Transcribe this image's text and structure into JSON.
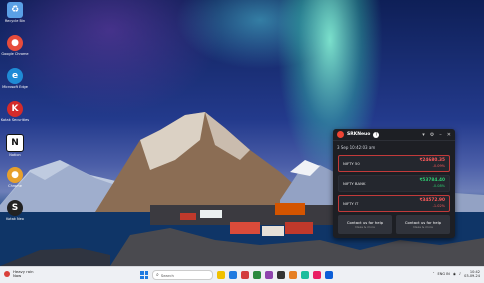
{
  "desktop": {
    "icons": [
      {
        "name": "Recycle Bin",
        "glyph": "♻",
        "color": "#5aa0e6"
      },
      {
        "name": "Google Chrome",
        "glyph": "●",
        "color": "#e74c3c"
      },
      {
        "name": "Microsoft Edge",
        "glyph": "e",
        "color": "#1f8bd6"
      },
      {
        "name": "Kotak Securities",
        "glyph": "K",
        "color": "#d42b2b"
      },
      {
        "name": "Notion",
        "glyph": "N",
        "color": "#111111"
      },
      {
        "name": "Chrome",
        "glyph": "●",
        "color": "#e7a02b"
      },
      {
        "name": "Kotak Neo",
        "glyph": "S",
        "color": "#222222"
      }
    ]
  },
  "widget": {
    "title": "SRKNeuo",
    "help": "?",
    "date_time": "3 Sep 10:42:03 am",
    "rows": [
      {
        "name": "NIFTY 50",
        "price": "₹24680.35",
        "change": "-0.09%",
        "dir": "down"
      },
      {
        "name": "NIFTY BANK",
        "price": "₹53784.40",
        "change": "-0.08%",
        "dir": "up"
      },
      {
        "name": "NIFTY IT",
        "price": "₹34572.90",
        "change": "-1.02%",
        "dir": "down"
      }
    ],
    "actions": [
      {
        "label": "Contact us for help",
        "sub": "Ideas & more"
      },
      {
        "label": "Contact us for help",
        "sub": "Ideas & more"
      }
    ]
  },
  "taskbar": {
    "weather_title": "Heavy rain",
    "weather_sub": "Now",
    "search_placeholder": "Search",
    "apps": [
      "#f0c000",
      "#1f7ae0",
      "#d23d3d",
      "#2b8a3e",
      "#8e44ad",
      "#333333",
      "#e67e22",
      "#1abc9c",
      "#e91e63",
      "#0b5ed7"
    ],
    "tray_lang": "ENG IN",
    "time": "10:42",
    "date": "03-09-24"
  }
}
